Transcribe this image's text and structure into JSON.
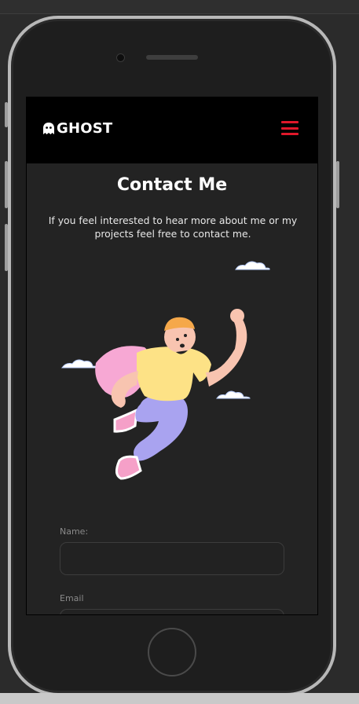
{
  "brand": {
    "name": "GHOST",
    "icon": "ghost-icon"
  },
  "nav": {
    "menu_icon": "hamburger-icon",
    "accent": "#e0182a"
  },
  "contact": {
    "title": "Contact Me",
    "subtitle": "If you feel interested to hear more about me or my projects feel free to contact me."
  },
  "form": {
    "name_label": "Name:",
    "name_value": "",
    "email_label": "Email",
    "email_value": ""
  },
  "colors": {
    "background": "#232323",
    "navbar": "#000000",
    "text": "#ffffff"
  }
}
